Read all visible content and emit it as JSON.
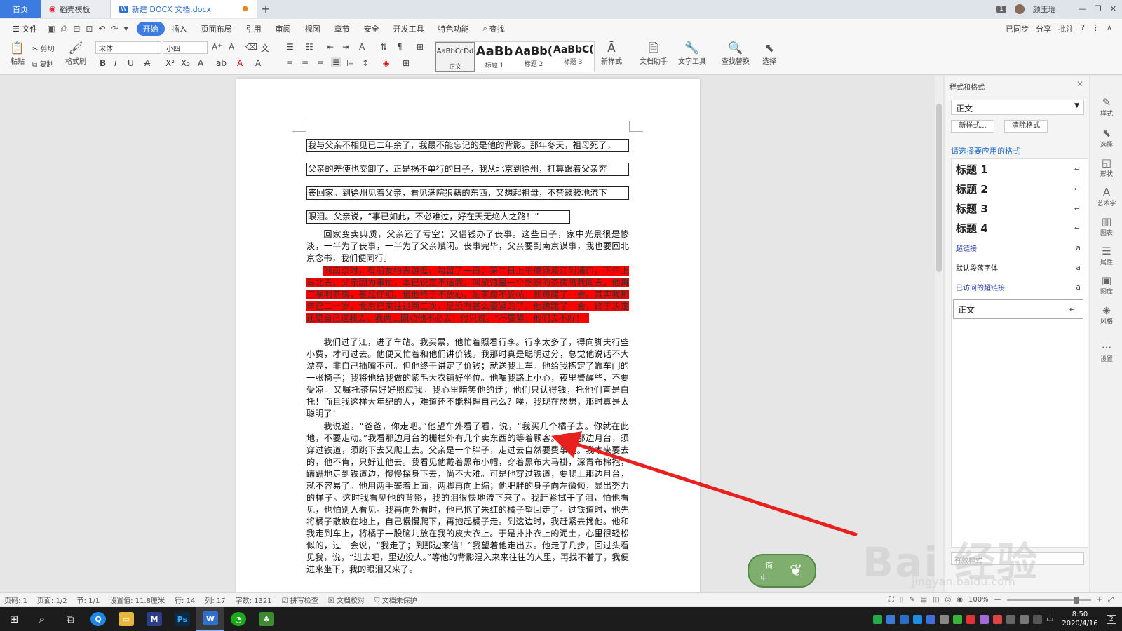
{
  "tabs": {
    "home": "首页",
    "template": "稻壳模板",
    "doc": "新建 DOCX 文档.docx",
    "plus": "+"
  },
  "titlebar": {
    "count": "1",
    "user": "颜玉瑶",
    "min": "—",
    "max": "❐",
    "close": "✕"
  },
  "menu": {
    "file": "☰ 文件",
    "items": [
      "开始",
      "插入",
      "页面布局",
      "引用",
      "审阅",
      "视图",
      "章节",
      "安全",
      "开发工具",
      "特色功能"
    ],
    "search": "查找",
    "right": [
      "已同步",
      "分享",
      "批注",
      "?",
      "⋮",
      "∧"
    ]
  },
  "ribbon": {
    "paste": "粘贴",
    "cut": "剪切",
    "copy": "复制",
    "format_painter": "格式刷",
    "font_name": "宋体",
    "font_size": "小四",
    "styles": [
      {
        "preview": "AaBbCcDd",
        "name": "正文"
      },
      {
        "preview": "AaBb",
        "name": "标题 1"
      },
      {
        "preview": "AaBb(",
        "name": "标题 2"
      },
      {
        "preview": "AaBbC(",
        "name": "标题 3"
      }
    ],
    "new_style": "新样式",
    "doc_helper": "文档助手",
    "text_tools": "文字工具",
    "find_replace": "查找替换",
    "select": "选择"
  },
  "document": {
    "line1": "我与父亲不相见已二年余了，我最不能忘记的是他的背影。那年冬天，祖母死了，",
    "line2": "父亲的差使也交卸了，正是祸不单行的日子，我从北京到徐州，打算跟着父亲奔",
    "line3": "丧回家。到徐州见着父亲，看见满院狼藉的东西，又想起祖母，不禁簌簌地流下",
    "line4": "眼泪。父亲说，“事已如此，不必难过，好在天无绝人之路！”",
    "para2": "回家变卖典质，父亲还了亏空；又借钱办了丧事。这些日子，家中光景很是惨淡，一半为了丧事，一半为了父亲赋闲。丧事完毕，父亲要到南京谋事，我也要回北京念书，我们便同行。",
    "para3": "到南京时，有朋友约去游逛，勾留了一日；第二日上午便须渡江到浦口，下午上车北去。父亲因为事忙，本已说定不送我，叫旅馆里一个熟识的茶房陪我同去。他再三嘱咐茶房，甚是仔细。但他终于不放心，怕茶房不妥帖；颇踌躇了一会。其实我那年已二十岁，北京已来往过两三次，是没有甚么要紧的了。他踌躇了一会，终于决定还是自己送我去。我两三回劝他不必去；他只说，“不要紧，他们去不好！”",
    "para4": "我们过了江，进了车站。我买票，他忙着照看行李。行李太多了，得向脚夫行些小费，才可过去。他便又忙着和他们讲价钱。我那时真是聪明过分，总觉他说话不大漂亮，非自己插嘴不可。但他终于讲定了价钱；就送我上车。他给我拣定了靠车门的一张椅子；我将他给我做的紫毛大衣铺好坐位。他嘱我路上小心，夜里警醒些，不要受凉。又嘱托茶房好好照应我。我心里暗笑他的迂；他们只认得钱，托他们直是白托！而且我这样大年纪的人，难道还不能料理自己么？唉，我现在想想，那时真是太聪明了！",
    "para5": "我说道，“爸爸，你走吧。”他望车外看了看，说，“我买几个橘子去。你就在此地，不要走动。”我看那边月台的栅栏外有几个卖东西的等着顾客。走到那边月台，须穿过铁道，须跳下去又爬上去。父亲是一个胖子，走过去自然要费事些。我本来要去的，他不肯，只好让他去。我看见他戴着黑布小帽，穿着黑布大马褂，深青布棉袍，蹒跚地走到铁道边，慢慢探身下去，尚不大难。可是他穿过铁道，要爬上那边月台，就不容易了。他用两手攀着上面，两脚再向上缩；他肥胖的身子向左微倾，显出努力的样子。这时我看见他的背影，我的泪很快地流下来了。我赶紧拭干了泪，怕他看见，也怕别人看见。我再向外看时，他已抱了朱红的橘子望回走了。过铁道时，他先将橘子散放在地上，自己慢慢爬下，再抱起橘子走。到这边时，我赶紧去搀他。他和我走到车上，将橘子一股脑儿放在我的皮大衣上。于是扑扑衣上的泥土，心里很轻松似的，过一会说，“我走了；到那边来信！”我望着他走出去。他走了几步，回过头看见我，说，“进去吧，里边没人。”等他的背影混入来来往往的人里，再找不着了，我便进来坐下，我的眼泪又来了。"
  },
  "panel": {
    "title": "样式和格式",
    "current": "正文",
    "new_style_btn": "新样式...",
    "clear_btn": "清除格式",
    "hint": "请选择要应用的格式",
    "items": [
      {
        "label": "标题  1",
        "kind": "h"
      },
      {
        "label": "标题  2",
        "kind": "h"
      },
      {
        "label": "标题  3",
        "kind": "h"
      },
      {
        "label": "标题  4",
        "kind": "h"
      },
      {
        "label": "超链接",
        "kind": "link"
      },
      {
        "label": "默认段落字体",
        "kind": "s"
      },
      {
        "label": "已访问的超链接",
        "kind": "link"
      },
      {
        "label": "正文",
        "kind": "box"
      }
    ],
    "bottom": "有效样式"
  },
  "righttools": [
    "样式",
    "选择",
    "形状",
    "艺术字",
    "图表",
    "属性",
    "图库",
    "风格",
    "设置"
  ],
  "status": {
    "page": "页码: 1",
    "pages": "页面: 1/2",
    "section": "节: 1/1",
    "setting": "设置值: 11.8厘米",
    "row": "行: 14",
    "col": "列: 17",
    "words": "字数: 1321",
    "spell": "拼写检查",
    "proof": "文档校对",
    "protect": "文档未保护",
    "zoom": "100%"
  },
  "ime": {
    "line1": "简",
    "line2": "中"
  },
  "taskbar": {
    "time": "8:50",
    "date": "2020/4/16",
    "lang": "中",
    "notify": "2"
  },
  "watermark": {
    "brand": "Bai 经验",
    "url": "jingyan.baidu.com"
  },
  "colors": {
    "accent": "#3c7be0",
    "highlight": "#ff0000",
    "arrow": "#e8201e"
  }
}
